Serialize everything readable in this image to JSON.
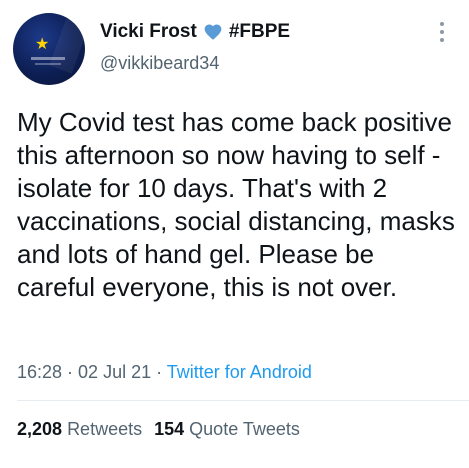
{
  "author": {
    "display_name": "Vicki Frost",
    "hashtag": "#FBPE",
    "handle": "@vikkibeard34"
  },
  "tweet": {
    "text": "My Covid test has come back positive this afternoon so now having to self - isolate for 10 days. That's with 2 vaccinations, social distancing, masks and lots of hand gel. Please be careful everyone, this is not over.",
    "time": "16:28",
    "separator1": " · ",
    "date": "02 Jul 21",
    "separator2": " · ",
    "source": "Twitter for Android"
  },
  "stats": {
    "retweets_count": "2,208",
    "retweets_label": "Retweets",
    "quotes_count": "154",
    "quotes_label": "Quote Tweets"
  },
  "colors": {
    "link_blue": "#1d9bf0",
    "heart_blue": "#5b9bd5",
    "muted_gray": "#536471"
  },
  "icons": {
    "heart": "blue-heart-icon",
    "more": "more-vertical-icon"
  }
}
